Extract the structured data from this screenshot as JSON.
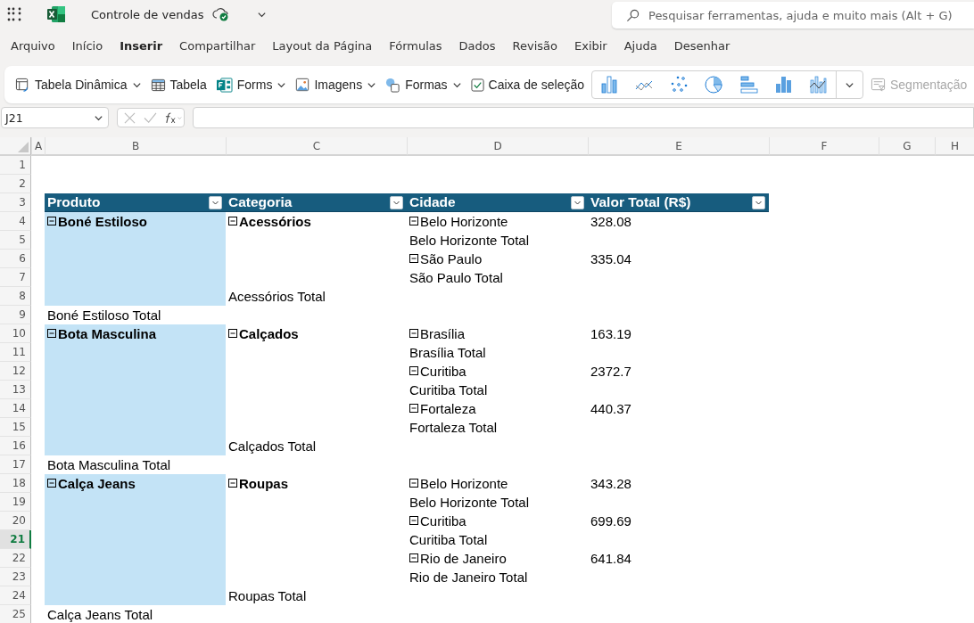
{
  "app_bar": {
    "document_title": "Controle de vendas",
    "search": {
      "placeholder": "Pesquisar ferramentas, ajuda e muito mais (Alt + G)"
    }
  },
  "menu_tabs": [
    {
      "label": "Arquivo",
      "selected": false
    },
    {
      "label": "Início",
      "selected": false
    },
    {
      "label": "Inserir",
      "selected": true
    },
    {
      "label": "Compartilhar",
      "selected": false
    },
    {
      "label": "Layout da Página",
      "selected": false
    },
    {
      "label": "Fórmulas",
      "selected": false
    },
    {
      "label": "Dados",
      "selected": false
    },
    {
      "label": "Revisão",
      "selected": false
    },
    {
      "label": "Exibir",
      "selected": false
    },
    {
      "label": "Ajuda",
      "selected": false
    },
    {
      "label": "Desenhar",
      "selected": false
    }
  ],
  "ribbon": [
    {
      "kind": "pivot",
      "label": "Tabela Dinâmica",
      "dropdown": true,
      "disabled": false
    },
    {
      "kind": "table",
      "label": "Tabela",
      "dropdown": false,
      "disabled": false
    },
    {
      "kind": "forms",
      "label": "Forms",
      "dropdown": true,
      "disabled": false
    },
    {
      "kind": "images",
      "label": "Imagens",
      "dropdown": true,
      "disabled": false
    },
    {
      "kind": "shapes",
      "label": "Formas",
      "dropdown": true,
      "disabled": false
    },
    {
      "kind": "checkbox",
      "label": "Caixa de seleção",
      "dropdown": false,
      "disabled": false
    },
    {
      "kind": "charts"
    },
    {
      "kind": "slicer",
      "label": "Segmentação",
      "dropdown": false,
      "disabled": true
    }
  ],
  "formula_bar": {
    "name_box": "J21"
  },
  "sheet": {
    "columns": [
      {
        "label": "A",
        "selected": false
      },
      {
        "label": "B",
        "selected": false
      },
      {
        "label": "C",
        "selected": false
      },
      {
        "label": "D",
        "selected": false
      },
      {
        "label": "E",
        "selected": false
      },
      {
        "label": "F",
        "selected": false
      },
      {
        "label": "G",
        "selected": false
      },
      {
        "label": "H",
        "selected": false
      }
    ],
    "pivot_headers": [
      "Produto",
      "Categoria",
      "Cidade",
      "Valor Total (R$)"
    ],
    "rows": [
      {
        "number": "1",
        "selected": false
      },
      {
        "number": "2",
        "selected": false
      },
      {
        "number": "3",
        "selected": false,
        "kind": "header"
      },
      {
        "number": "4",
        "selected": false,
        "band": true,
        "b": {
          "text": "Boné Estiloso",
          "bold": true,
          "expanded": true
        },
        "c": {
          "text": "Acessórios",
          "bold": true,
          "expanded": true
        },
        "d": {
          "text": "Belo Horizonte",
          "bold": false,
          "expanded": true
        },
        "e": {
          "text": "328.08"
        }
      },
      {
        "number": "5",
        "selected": false,
        "band": true,
        "d": {
          "text": "Belo Horizonte Total"
        }
      },
      {
        "number": "6",
        "selected": false,
        "band": true,
        "d": {
          "text": "São Paulo",
          "bold": false,
          "expanded": true
        },
        "e": {
          "text": "335.04"
        }
      },
      {
        "number": "7",
        "selected": false,
        "band": true,
        "d": {
          "text": "São Paulo Total"
        }
      },
      {
        "number": "8",
        "selected": false,
        "band": true,
        "c": {
          "text": "Acessórios Total"
        }
      },
      {
        "number": "9",
        "selected": false,
        "b": {
          "text": "Boné Estiloso Total"
        }
      },
      {
        "number": "10",
        "selected": false,
        "band": true,
        "b": {
          "text": "Bota Masculina",
          "bold": true,
          "expanded": true
        },
        "c": {
          "text": "Calçados",
          "bold": true,
          "expanded": true
        },
        "d": {
          "text": "Brasília",
          "bold": false,
          "expanded": true
        },
        "e": {
          "text": "163.19"
        }
      },
      {
        "number": "11",
        "selected": false,
        "band": true,
        "d": {
          "text": "Brasília Total"
        }
      },
      {
        "number": "12",
        "selected": false,
        "band": true,
        "d": {
          "text": "Curitiba",
          "bold": false,
          "expanded": true
        },
        "e": {
          "text": "2372.7"
        }
      },
      {
        "number": "13",
        "selected": false,
        "band": true,
        "d": {
          "text": "Curitiba Total"
        }
      },
      {
        "number": "14",
        "selected": false,
        "band": true,
        "d": {
          "text": "Fortaleza",
          "bold": false,
          "expanded": true
        },
        "e": {
          "text": "440.37"
        }
      },
      {
        "number": "15",
        "selected": false,
        "band": true,
        "d": {
          "text": "Fortaleza Total"
        }
      },
      {
        "number": "16",
        "selected": false,
        "band": true,
        "c": {
          "text": "Calçados Total"
        }
      },
      {
        "number": "17",
        "selected": false,
        "b": {
          "text": "Bota Masculina Total"
        }
      },
      {
        "number": "18",
        "selected": false,
        "band": true,
        "b": {
          "text": "Calça Jeans",
          "bold": true,
          "expanded": true
        },
        "c": {
          "text": "Roupas",
          "bold": true,
          "expanded": true
        },
        "d": {
          "text": "Belo Horizonte",
          "bold": false,
          "expanded": true
        },
        "e": {
          "text": "343.28"
        }
      },
      {
        "number": "19",
        "selected": false,
        "band": true,
        "d": {
          "text": "Belo Horizonte Total"
        }
      },
      {
        "number": "20",
        "selected": false,
        "band": true,
        "d": {
          "text": "Curitiba",
          "bold": false,
          "expanded": true
        },
        "e": {
          "text": "699.69"
        }
      },
      {
        "number": "21",
        "selected": true,
        "band": true,
        "d": {
          "text": "Curitiba Total"
        }
      },
      {
        "number": "22",
        "selected": false,
        "band": true,
        "d": {
          "text": "Rio de Janeiro",
          "bold": false,
          "expanded": true
        },
        "e": {
          "text": "641.84"
        }
      },
      {
        "number": "23",
        "selected": false,
        "band": true,
        "d": {
          "text": "Rio de Janeiro Total"
        }
      },
      {
        "number": "24",
        "selected": false,
        "band": true,
        "c": {
          "text": "Roupas Total"
        }
      },
      {
        "number": "25",
        "selected": false,
        "b": {
          "text": "Calça Jeans Total"
        }
      }
    ]
  }
}
